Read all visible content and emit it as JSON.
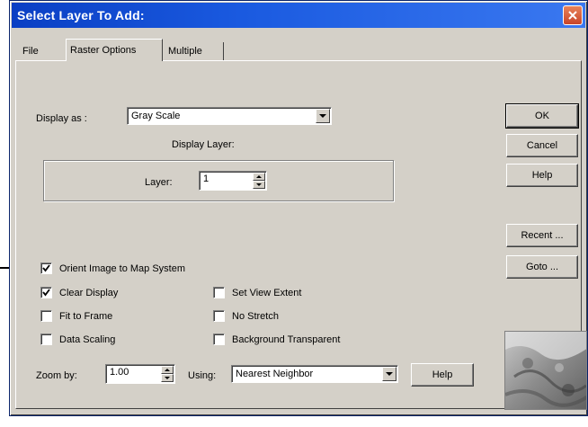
{
  "dialog": {
    "title": "Select Layer To Add:"
  },
  "tabs": [
    {
      "label": "File",
      "active": false
    },
    {
      "label": "Raster Options",
      "active": true
    },
    {
      "label": "Multiple",
      "active": false
    }
  ],
  "display_as": {
    "label": "Display as :",
    "value": "Gray Scale"
  },
  "display_layer": {
    "heading": "Display Layer:",
    "layer_label": "Layer:",
    "layer_value": "1"
  },
  "buttons": {
    "ok": "OK",
    "cancel": "Cancel",
    "help": "Help",
    "recent": "Recent ...",
    "goto": "Goto ...",
    "zoom_help": "Help"
  },
  "checkboxes": [
    {
      "label": "Orient Image to Map System",
      "checked": true
    },
    {
      "label": "Clear Display",
      "checked": true
    },
    {
      "label": "Fit to Frame",
      "checked": false
    },
    {
      "label": "Data Scaling",
      "checked": false
    },
    {
      "label": "Set View Extent",
      "checked": false
    },
    {
      "label": "No Stretch",
      "checked": false
    },
    {
      "label": "Background Transparent",
      "checked": false
    }
  ],
  "zoom": {
    "label": "Zoom by:",
    "value": "1.00",
    "using_label": "Using:",
    "method": "Nearest Neighbor"
  },
  "colors": {
    "titlebar": "#0a3fc4",
    "dialog_face": "#d4d0c8",
    "close_button": "#c8452a"
  }
}
